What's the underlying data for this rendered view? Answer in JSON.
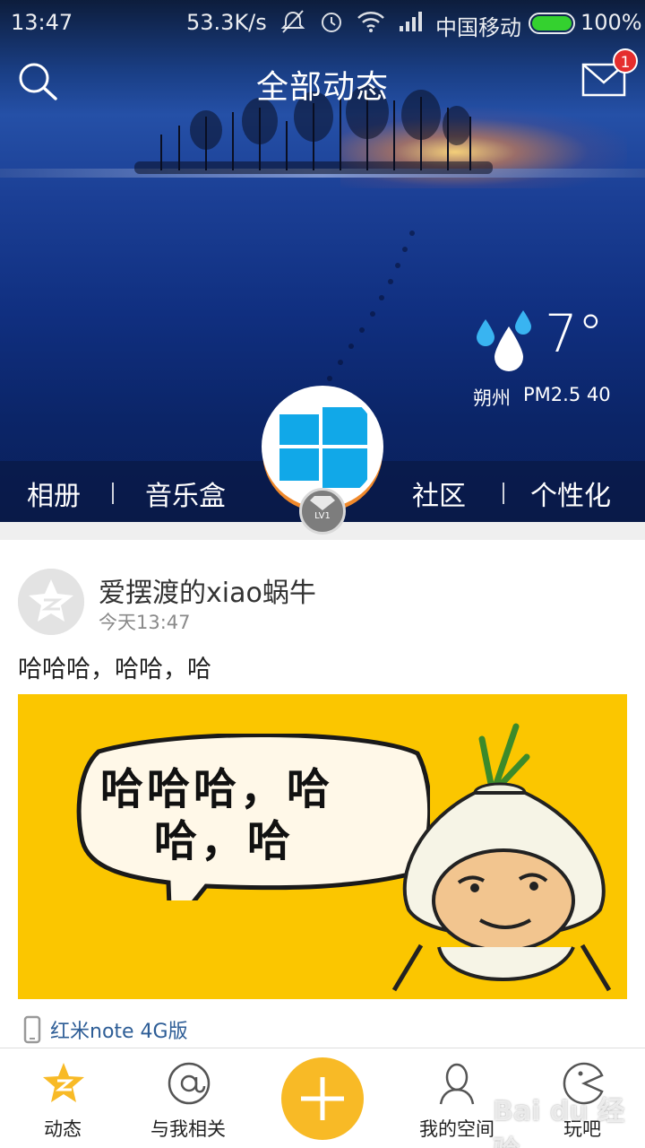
{
  "statusbar": {
    "time": "13:47",
    "speed": "53.3K/s",
    "carrier": "中国移动",
    "battery": "100%",
    "battery_level": 1.0,
    "icons": [
      "mute-icon",
      "alarm-icon",
      "wifi-icon",
      "signal-icon"
    ]
  },
  "header": {
    "title": "全部动态",
    "mail_badge": "1"
  },
  "weather": {
    "temp": "7°",
    "city": "朔州",
    "pm": "PM2.5  40",
    "icon": "rain-drops-icon"
  },
  "tabs": [
    "相册",
    "音乐盒",
    "社区",
    "个性化"
  ],
  "profile": {
    "level": "LV1"
  },
  "post": {
    "author": "爱摆渡的xiao蜗牛",
    "time": "今天13:47",
    "text": "哈哈哈，哈哈，哈",
    "image_text_line1": "哈哈哈，哈",
    "image_text_line2": "哈，哈",
    "device": "红米note 4G版"
  },
  "bottom_nav": [
    {
      "label": "动态",
      "icon": "star-icon"
    },
    {
      "label": "与我相关",
      "icon": "at-icon"
    },
    {
      "label": "",
      "icon": "plus-icon"
    },
    {
      "label": "我的空间",
      "icon": "person-icon"
    },
    {
      "label": "玩吧",
      "icon": "pacman-icon"
    }
  ],
  "colors": {
    "accent": "#f8ba26",
    "badge": "#e52d2d",
    "link": "#2d5d96",
    "battery": "#34d12f"
  },
  "watermark": "Bai du 经验"
}
